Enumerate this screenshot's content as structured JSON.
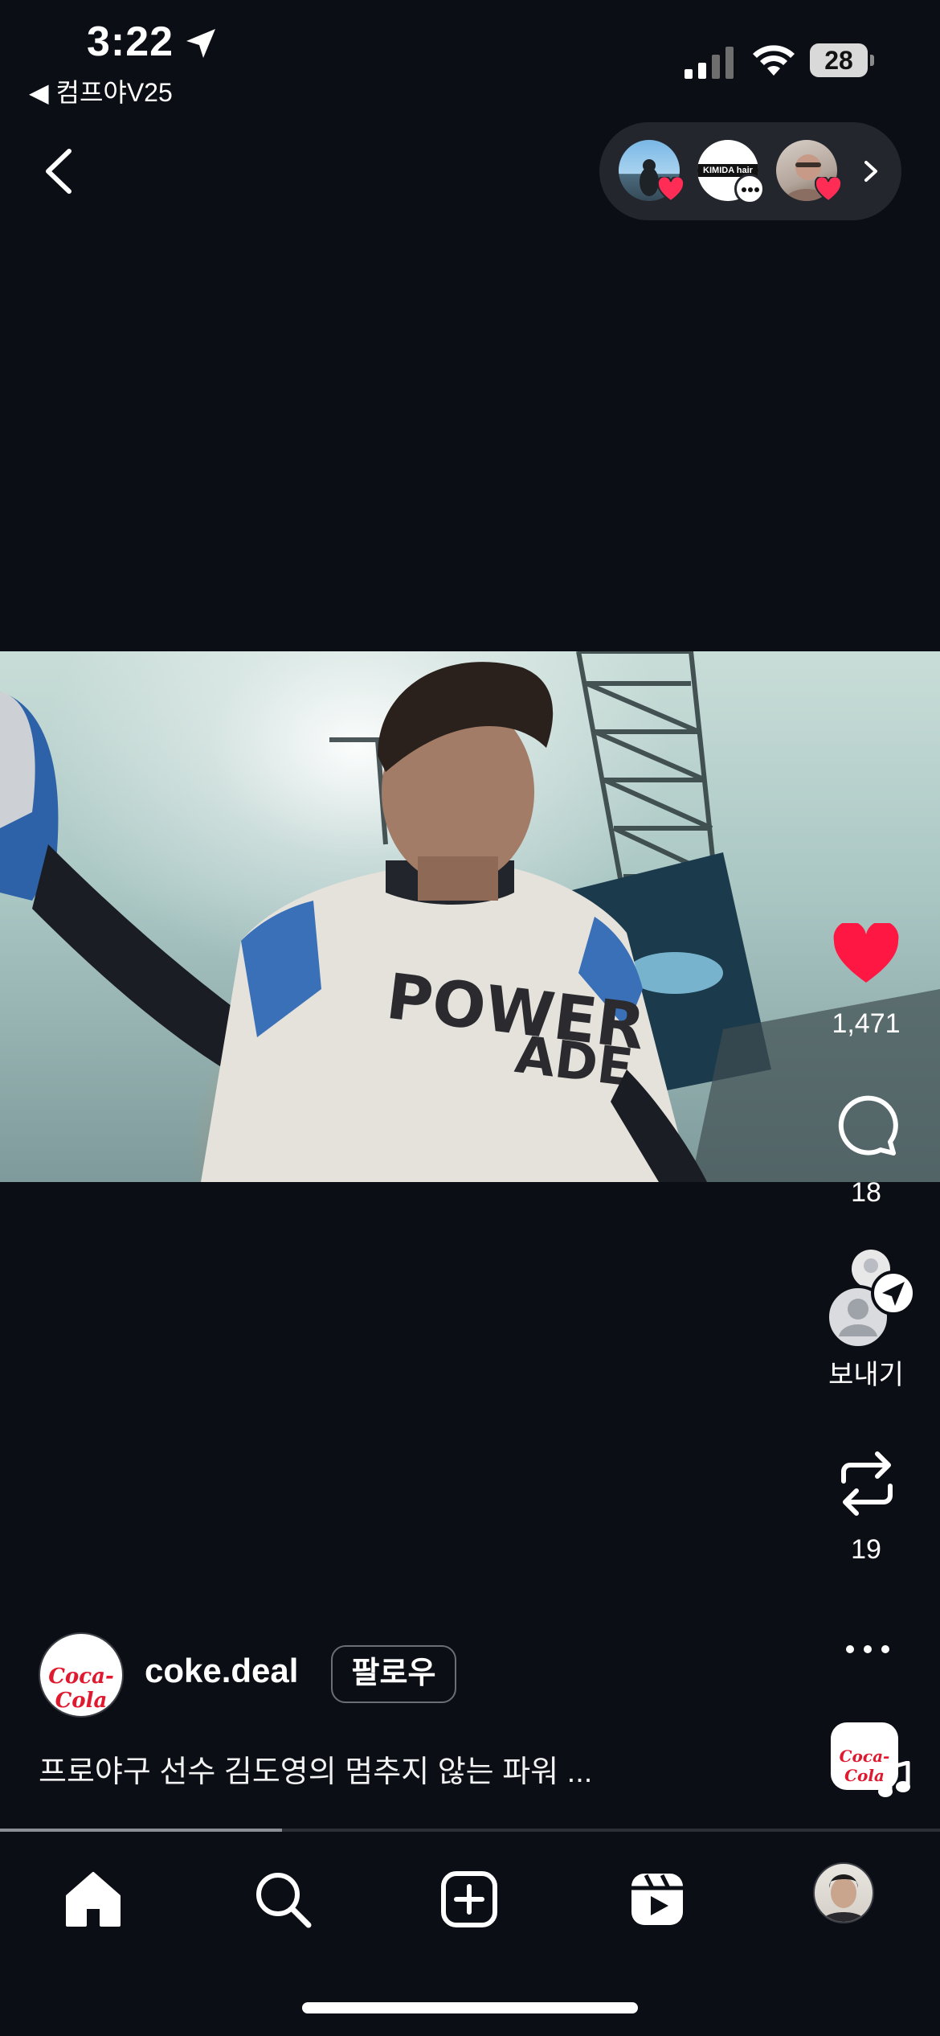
{
  "status_bar": {
    "time": "3:22",
    "back_app_label": "◀ 컴프야V25",
    "battery": "28"
  },
  "top_nav": {
    "back_icon": "chevron-left-icon",
    "stories": [
      {
        "name": "story-avatar-1",
        "badge": "heart-icon"
      },
      {
        "name": "story-avatar-2",
        "text": "KIMIDA hair",
        "badge": "comment-dots-icon"
      },
      {
        "name": "story-avatar-3",
        "badge": "heart-icon"
      }
    ],
    "stories_chevron_icon": "chevron-right-icon"
  },
  "actions": {
    "like_count": "1,471",
    "comment_count": "18",
    "share_label": "보내기",
    "repost_count": "19",
    "like_color": "#ff1744"
  },
  "post": {
    "username": "coke.deal",
    "follow_label": "팔로우",
    "caption": "프로야구 선수 김도영의 멈추지 않는 파워 ...",
    "brand_logo_text": "Coca-Cola",
    "progress_fraction": 0.3
  },
  "tab_bar": {
    "items": [
      "home-icon",
      "search-icon",
      "create-icon",
      "reels-icon",
      "profile-avatar"
    ]
  },
  "colors": {
    "background": "#0b0e14",
    "brand_red": "#e0192f"
  }
}
